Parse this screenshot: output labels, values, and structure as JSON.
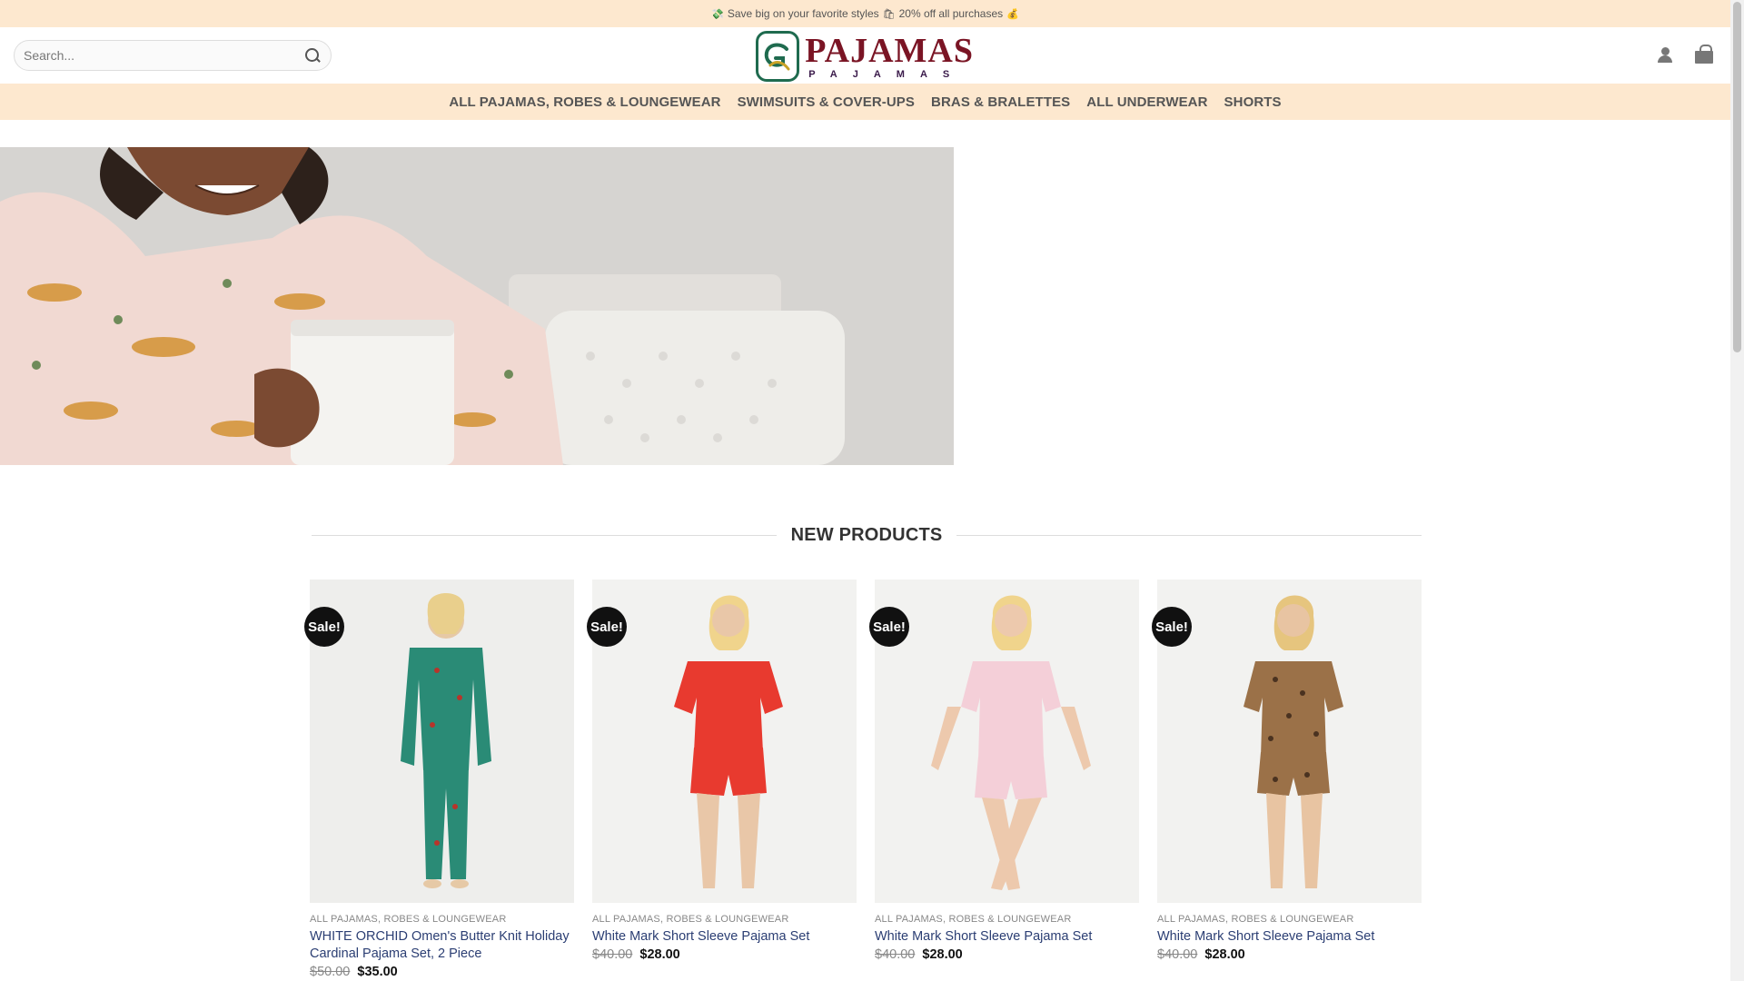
{
  "promo": {
    "text_a": "Save big on your favorite styles",
    "text_b": "20% off all purchases"
  },
  "search": {
    "placeholder": "Search..."
  },
  "logo": {
    "title": "PAJAMAS",
    "subtitle": "PAJAMAS"
  },
  "nav": {
    "items": [
      {
        "label": "ALL PAJAMAS, ROBES & LOUNGEWEAR"
      },
      {
        "label": "SWIMSUITS & COVER-UPS"
      },
      {
        "label": "BRAS & BRALETTES"
      },
      {
        "label": "ALL UNDERWEAR"
      },
      {
        "label": "SHORTS"
      }
    ]
  },
  "section": {
    "title": "NEW PRODUCTS"
  },
  "products": [
    {
      "badge": "Sale!",
      "category": "ALL PAJAMAS, ROBES & LOUNGEWEAR",
      "name": "WHITE ORCHID Omen's Butter Knit Holiday Cardinal Pajama Set, 2 Piece",
      "old_price": "$50.00",
      "price": "$35.00",
      "color": "#2a8b76"
    },
    {
      "badge": "Sale!",
      "category": "ALL PAJAMAS, ROBES & LOUNGEWEAR",
      "name": "White Mark Short Sleeve Pajama Set",
      "old_price": "$40.00",
      "price": "$28.00",
      "color": "#e83a2f"
    },
    {
      "badge": "Sale!",
      "category": "ALL PAJAMAS, ROBES & LOUNGEWEAR",
      "name": "White Mark Short Sleeve Pajama Set",
      "old_price": "$40.00",
      "price": "$28.00",
      "color": "#f4cfd8"
    },
    {
      "badge": "Sale!",
      "category": "ALL PAJAMAS, ROBES & LOUNGEWEAR",
      "name": "White Mark Short Sleeve Pajama Set",
      "old_price": "$40.00",
      "price": "$28.00",
      "color": "#9b7148"
    }
  ],
  "colors": {
    "promo_bg": "#fde8cf",
    "nav_bg": "#fde8cf",
    "logo_red": "#7a1424",
    "logo_green": "#1f6b4f",
    "link_blue": "#2b3e73"
  },
  "icons": [
    "money-icon",
    "gift-icon",
    "bag-icon",
    "search-icon",
    "user-icon",
    "cart-icon"
  ]
}
